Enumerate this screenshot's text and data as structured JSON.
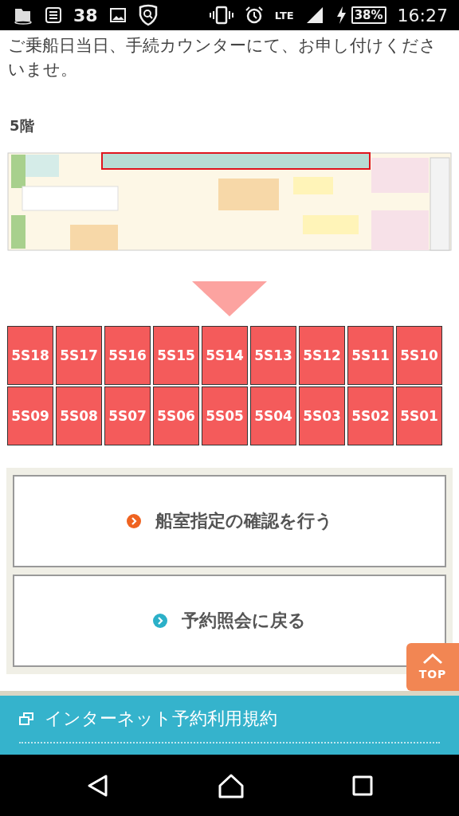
{
  "status_bar": {
    "notification_count": "38",
    "network": "LTE",
    "battery": "38%",
    "time": "16:27"
  },
  "intro_text": "ご乗船日当日、手続カウンターにて、お申し付けくださいませ。",
  "floor_title": "5階",
  "cabins": [
    {
      "label": "5S18"
    },
    {
      "label": "5S17"
    },
    {
      "label": "5S16"
    },
    {
      "label": "5S15"
    },
    {
      "label": "5S14"
    },
    {
      "label": "5S13"
    },
    {
      "label": "5S12"
    },
    {
      "label": "5S11"
    },
    {
      "label": "5S10"
    },
    {
      "label": "5S09"
    },
    {
      "label": "5S08"
    },
    {
      "label": "5S07"
    },
    {
      "label": "5S06"
    },
    {
      "label": "5S05"
    },
    {
      "label": "5S04"
    },
    {
      "label": "5S03"
    },
    {
      "label": "5S02"
    },
    {
      "label": "5S01"
    }
  ],
  "buttons": [
    {
      "label": "船室指定の確認を行う",
      "kind": "primary"
    },
    {
      "label": "予約照会に戻る",
      "kind": "secondary"
    }
  ],
  "top_button": "TOP",
  "footer_link": "インターネット予約利用規約"
}
